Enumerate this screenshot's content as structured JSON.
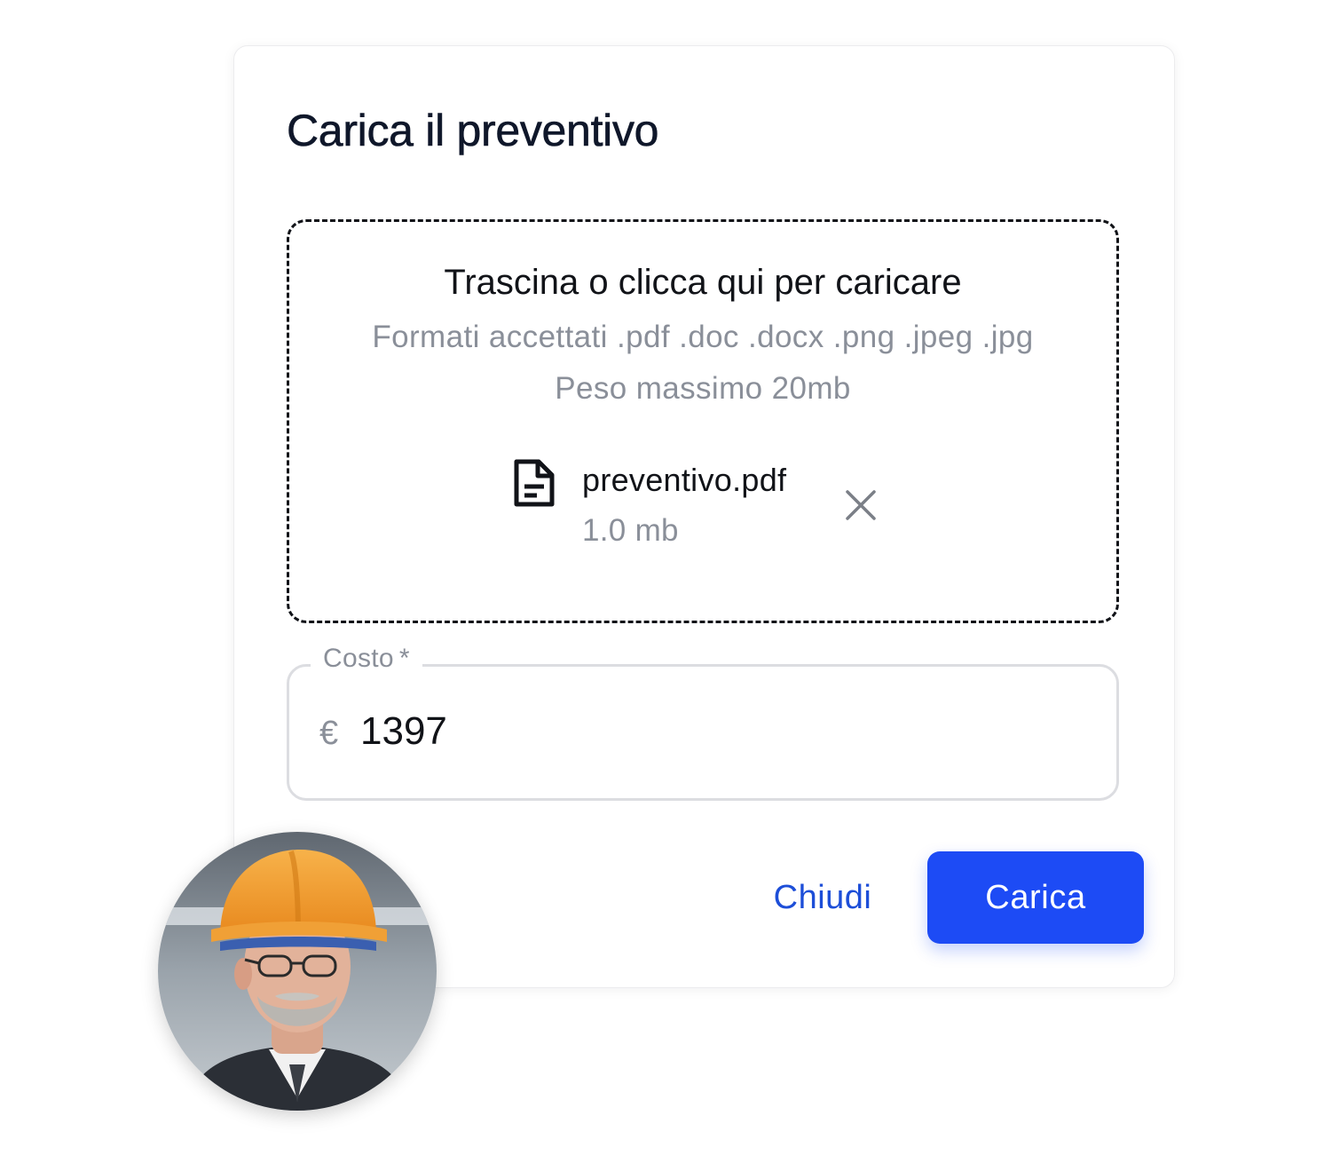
{
  "dialog": {
    "title": "Carica il preventivo"
  },
  "dropzone": {
    "title": "Trascina o clicca qui per caricare",
    "formats": "Formati accettati .pdf .doc .docx .png .jpeg .jpg",
    "max_size": "Peso massimo 20mb",
    "file": {
      "name": "preventivo.pdf",
      "size": "1.0 mb",
      "icon": "document-icon",
      "remove_icon": "close-icon"
    }
  },
  "cost": {
    "label": "Costo",
    "required_marker": "*",
    "currency": "€",
    "value": "1397"
  },
  "actions": {
    "close_label": "Chiudi",
    "upload_label": "Carica"
  },
  "colors": {
    "primary": "#1d4bf5",
    "link": "#1d4ed8",
    "text": "#111318",
    "muted": "#8a8f99"
  }
}
